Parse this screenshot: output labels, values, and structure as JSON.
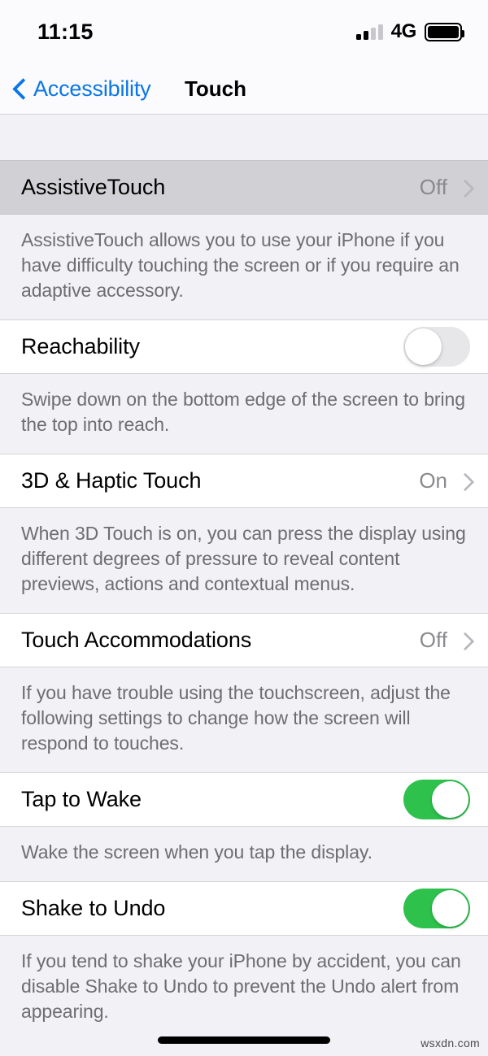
{
  "status_bar": {
    "time": "11:15",
    "carrier": "4G",
    "signal_bars_filled": 2,
    "signal_bars_total": 4,
    "battery_level_percent": 100
  },
  "nav": {
    "back_label": "Accessibility",
    "title": "Touch",
    "back_icon": "chevron-left-icon",
    "accent_color": "#0a76e8"
  },
  "sections": [
    {
      "row": {
        "label": "AssistiveTouch",
        "value": "Off",
        "type": "disclosure",
        "highlighted": true
      },
      "footer": "AssistiveTouch allows you to use your iPhone if you have difficulty touching the screen or if you require an adaptive accessory."
    },
    {
      "row": {
        "label": "Reachability",
        "value": "",
        "type": "toggle",
        "toggle_on": false,
        "highlighted": false
      },
      "footer": "Swipe down on the bottom edge of the screen to bring the top into reach."
    },
    {
      "row": {
        "label": "3D & Haptic Touch",
        "value": "On",
        "type": "disclosure",
        "highlighted": false
      },
      "footer": "When 3D Touch is on, you can press the display using different degrees of pressure to reveal content previews, actions and contextual menus."
    },
    {
      "row": {
        "label": "Touch Accommodations",
        "value": "Off",
        "type": "disclosure",
        "highlighted": false
      },
      "footer": "If you have trouble using the touchscreen, adjust the following settings to change how the screen will respond to touches."
    },
    {
      "row": {
        "label": "Tap to Wake",
        "value": "",
        "type": "toggle",
        "toggle_on": true,
        "highlighted": false
      },
      "footer": "Wake the screen when you tap the display."
    },
    {
      "row": {
        "label": "Shake to Undo",
        "value": "",
        "type": "toggle",
        "toggle_on": true,
        "highlighted": false
      },
      "footer": "If you tend to shake your iPhone by accident, you can disable Shake to Undo to prevent the Undo alert from appearing."
    }
  ],
  "colors": {
    "toggle_on": "#2ec24d",
    "toggle_off": "#e7e7e9",
    "group_background": "#f2f1f6",
    "row_background": "#ffffff",
    "row_highlight": "#d1d0d4",
    "secondary_text": "#8a8a8e"
  },
  "watermark": "wsxdn.com",
  "home_indicator": true
}
